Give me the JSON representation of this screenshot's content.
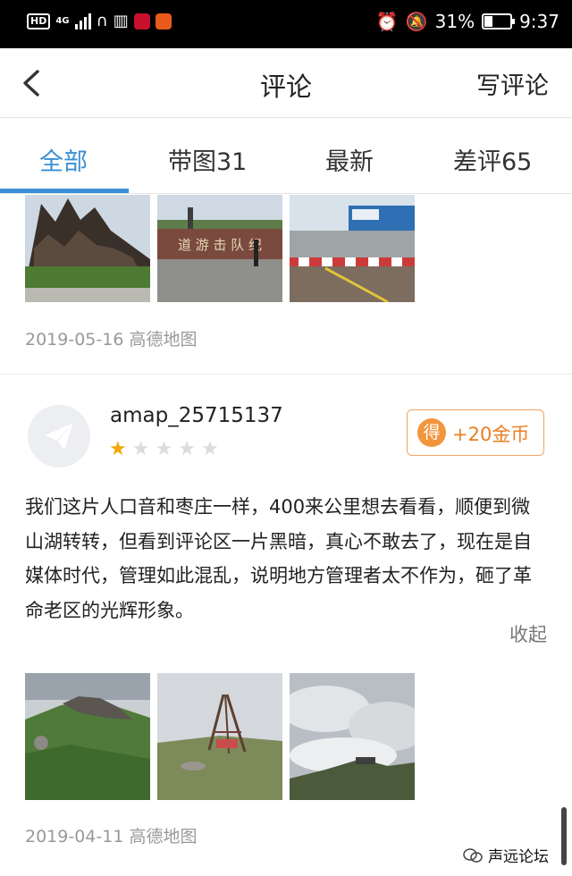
{
  "status_bar": {
    "hd": "HD",
    "network": "4G",
    "battery": "31%",
    "time": "9:37"
  },
  "header": {
    "title": "评论",
    "write_label": "写评论"
  },
  "tabs": [
    {
      "label": "全部"
    },
    {
      "label": "带图31"
    },
    {
      "label": "最新"
    },
    {
      "label": "差评65"
    }
  ],
  "previous_review": {
    "meta": "2019-05-16 高德地图",
    "sign_text": "道 游 击 队 纪"
  },
  "review": {
    "username": "amap_25715137",
    "rating": 1,
    "reward": "+20金币",
    "reward_icon": "得",
    "text": "我们这片人口音和枣庄一样，400来公里想去看看，顺便到微山湖转转，但看到评论区一片黑暗，真心不敢去了，现在是自媒体时代，管理如此混乱，说明地方管理者太不作为，砸了革命老区的光辉形象。",
    "collapse_label": "收起",
    "meta": "2019-04-11 高德地图"
  },
  "watermark": "声远论坛",
  "colors": {
    "accent": "#3a8fd6",
    "star": "#f5a70b",
    "reward": "#ea7f21"
  }
}
